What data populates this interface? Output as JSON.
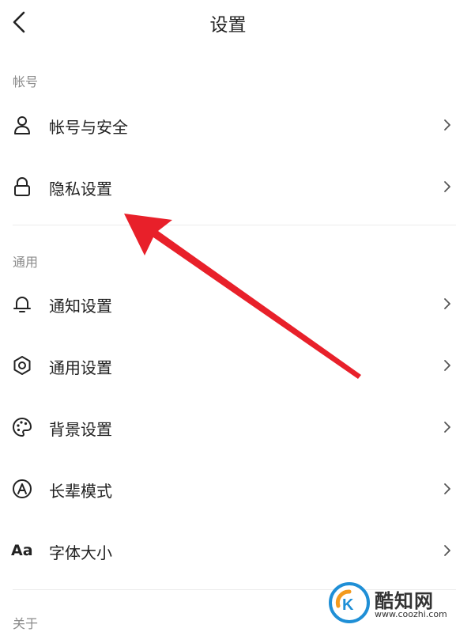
{
  "header": {
    "title": "设置"
  },
  "sections": {
    "account": "帐号",
    "general": "通用",
    "about": "关于"
  },
  "rows": {
    "account_security": "帐号与安全",
    "privacy": "隐私设置",
    "notification": "通知设置",
    "general_settings": "通用设置",
    "background": "背景设置",
    "elder_mode": "长辈模式",
    "font_size": "字体大小",
    "font_icon_text": "Aa"
  },
  "watermark": {
    "name": "酷知网",
    "url": "www.coozhi.com"
  },
  "colors": {
    "arrow": "#e8202a",
    "wm_blue": "#1f8fd6",
    "wm_orange": "#f39a1e"
  },
  "icons": {
    "back": "chevron-left-icon",
    "account_security": "user-icon",
    "privacy": "lock-icon",
    "notification": "bell-icon",
    "general_settings": "gear-icon",
    "background": "palette-icon",
    "elder_mode": "elder-mode-icon",
    "chevron": "chevron-right-icon"
  }
}
